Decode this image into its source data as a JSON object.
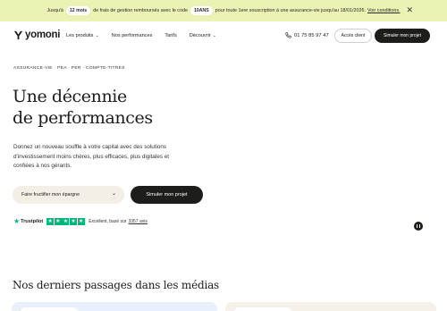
{
  "banner": {
    "text_before": "Jusqu'à",
    "months_pill": "12 mois",
    "text_middle": "de frais de gestion remboursés avec le code",
    "code_pill": "10ANS",
    "text_after": "pour toute 1ere souscription à une assurance-vie jusqu'au 18/01/2026.",
    "conditions_link": "Voir conditions.",
    "close_icon": "close-icon"
  },
  "nav": {
    "logo_text": "yomoni",
    "items": [
      {
        "label": "Les produits",
        "has_chevron": true
      },
      {
        "label": "Nos performances",
        "has_chevron": false
      },
      {
        "label": "Tarifs",
        "has_chevron": false
      },
      {
        "label": "Découvrir",
        "has_chevron": true
      }
    ],
    "phone": "01 75 85 97 47",
    "client_button": "Accès client",
    "simulate_button": "Simuler mon projet"
  },
  "hero": {
    "kicker": "ASSURANCE-VIE · PEA · PER · COMPTE-TITRES",
    "title_line1": "Une décennie",
    "title_line2": "de performances",
    "lead_line1": "Donnez un nouveau souffle à votre capital avec des solutions",
    "lead_line2": "d'investissement moins chères, plus efficaces, plus digitales et",
    "lead_line3": "confiées à nos gérants.",
    "select_value": "Faire fructifier mon épargne",
    "cta_button": "Simuler mon projet"
  },
  "trustpilot": {
    "name": "Trustpilot",
    "rating_stars": 5,
    "rating_text": "Excellent, basé sur",
    "reviews_count": "3357 avis"
  },
  "media": {
    "title": "Nos derniers passages dans les médias"
  },
  "colors": {
    "banner_bg": "#eaf2b4",
    "dark": "#1d1d1b",
    "trustpilot_green": "#00b67a",
    "select_bg": "#f3efe6",
    "card_blue": "#e8f0fb",
    "card_beige": "#f5f1e8"
  }
}
